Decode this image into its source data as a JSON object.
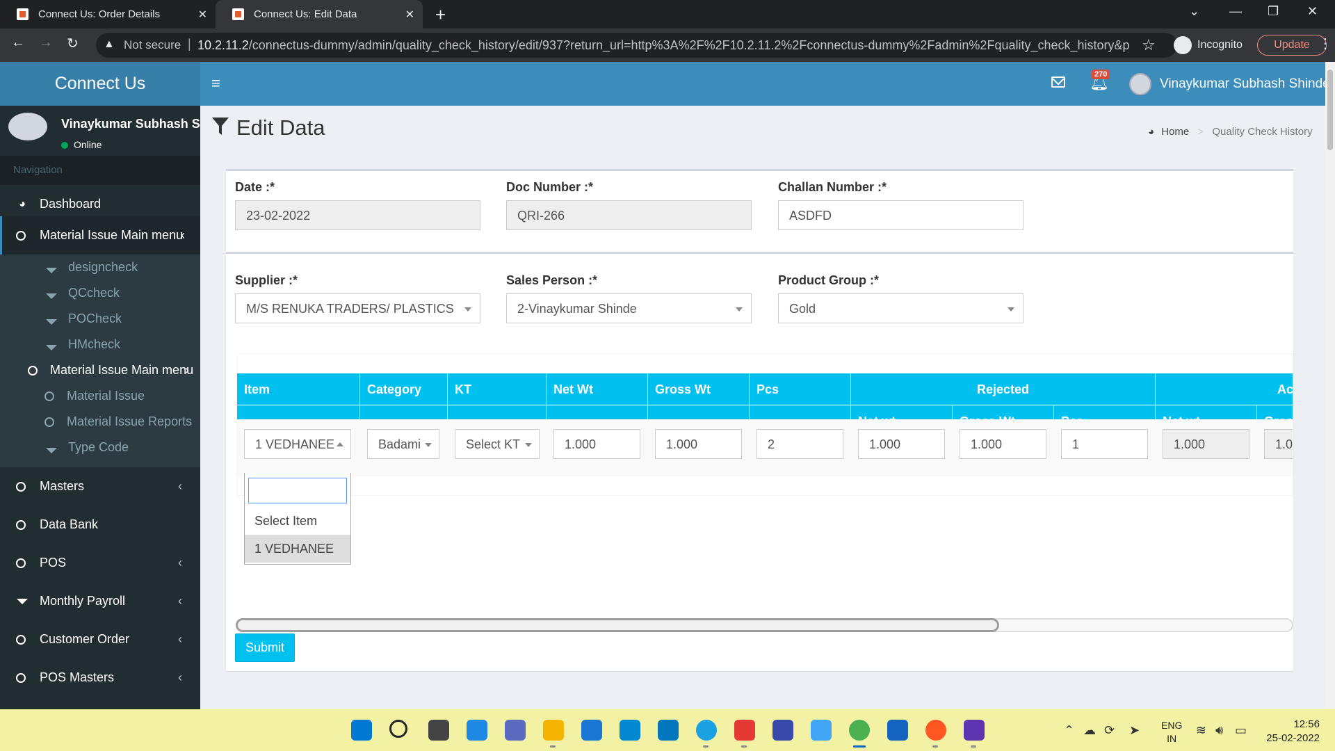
{
  "browser": {
    "tabs": [
      {
        "title": "Connect Us: Order Details"
      },
      {
        "title": "Connect Us: Edit Data"
      }
    ],
    "not_secure": "Not secure",
    "url_host": "10.2.11.2",
    "url_path": "/connectus-dummy/admin/quality_check_history/edit/937?return_url=http%3A%2F%2F10.2.11.2%2Fconnectus-dummy%2Fadmin%2Fquality_check_history&parent...",
    "incognito": "Incognito",
    "update": "Update"
  },
  "app": {
    "logo": "Connect Us",
    "notification_count": "270",
    "user_name": "Vinaykumar Subhash Shinde"
  },
  "sidebar": {
    "user_name": "Vinaykumar Subhash Shinde",
    "status": "Online",
    "nav_header": "Navigation",
    "items": [
      {
        "label": "Dashboard"
      },
      {
        "label": "Material Issue Main menu"
      },
      {
        "label": "Masters"
      },
      {
        "label": "Data Bank"
      },
      {
        "label": "POS"
      },
      {
        "label": "Monthly Payroll"
      },
      {
        "label": "Customer Order"
      },
      {
        "label": "POS Masters"
      }
    ],
    "sub_items": [
      {
        "label": "designcheck"
      },
      {
        "label": "QCcheck"
      },
      {
        "label": "POCheck"
      },
      {
        "label": "HMcheck"
      },
      {
        "label": "Material Issue Main menu"
      },
      {
        "label": "Material Issue"
      },
      {
        "label": "Material Issue Reports"
      },
      {
        "label": "Type Code"
      }
    ]
  },
  "page": {
    "title": "Edit Data",
    "breadcrumb": {
      "home": "Home",
      "current": "Quality Check History"
    }
  },
  "form": {
    "date": {
      "label": "Date :*",
      "value": "23-02-2022"
    },
    "doc_number": {
      "label": "Doc Number :*",
      "value": "QRI-266"
    },
    "challan_number": {
      "label": "Challan Number :*",
      "value": "ASDFD"
    },
    "supplier": {
      "label": "Supplier :*",
      "value": "M/S RENUKA TRADERS/ PLASTICS"
    },
    "sales_person": {
      "label": "Sales Person :*",
      "value": "2-Vinaykumar Shinde"
    },
    "product_group": {
      "label": "Product Group :*",
      "value": "Gold"
    }
  },
  "table": {
    "headers": {
      "item": "Item",
      "category": "Category",
      "kt": "KT",
      "net_wt": "Net Wt",
      "gross_wt": "Gross Wt",
      "pcs": "Pcs",
      "rejected": "Rejected",
      "accepted_partial": "Ac",
      "sub_net_wt": "Net wt",
      "sub_gross_wt": "Gross Wt",
      "sub_pcs": "Pcs",
      "sub_net_wt2": "Net wt",
      "sub_gross_partial": "Gros"
    },
    "row": {
      "item": "1 VEDHANEE",
      "category": "Badami",
      "kt": "Select KT",
      "net_wt": "1.000",
      "gross_wt": "1.000",
      "pcs": "2",
      "rej_net_wt": "1.000",
      "rej_gross_wt": "1.000",
      "rej_pcs": "1",
      "acc_net_wt": "1.000",
      "acc_gross_partial": "1.0"
    },
    "dropdown_options": [
      "Select Item",
      "1 VEDHANEE"
    ]
  },
  "submit_label": "Submit",
  "taskbar": {
    "lang_1": "ENG",
    "lang_2": "IN",
    "time": "12:56",
    "date": "25-02-2022"
  },
  "colors": {
    "header_blue": "#3c8dbc",
    "logo_blue": "#367fa9",
    "sidebar": "#222d32",
    "table_header": "#00c0ef",
    "badge": "#dd4b39"
  }
}
